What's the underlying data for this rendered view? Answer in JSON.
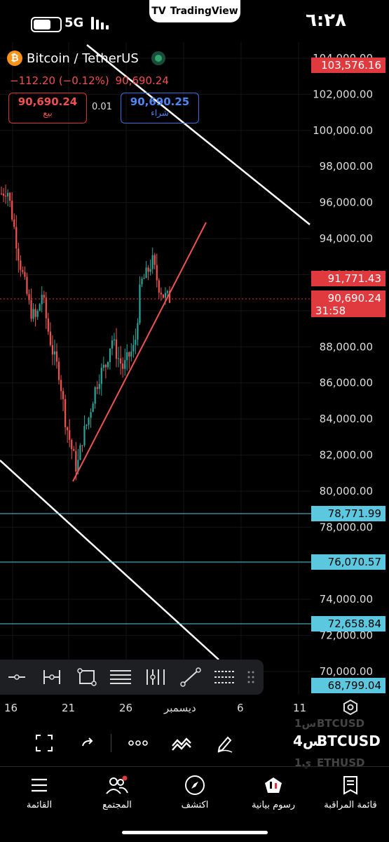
{
  "status_bar": {
    "time": "٦:٢٨",
    "network": "5G",
    "app_pill": "TradingView"
  },
  "symbol": {
    "name": "Bitcoin / TetherUS",
    "change": "−112.20 (−0.12%)",
    "last": "90,690.24",
    "sell": {
      "price": "90,690.24",
      "label": "بيع"
    },
    "buy": {
      "price": "90,690.25",
      "label": "شراء"
    },
    "spread": "0.01"
  },
  "price_axis": {
    "ticks": [
      "104,000.00",
      "102,000.00",
      "100,000.00",
      "98,000.00",
      "96,000.00",
      "94,000.00",
      "92,000.00",
      "90,000.00",
      "88,000.00",
      "86,000.00",
      "84,000.00",
      "82,000.00",
      "80,000.00",
      "78,000.00",
      "76,000.00",
      "74,000.00",
      "72,000.00",
      "70,000.00"
    ],
    "labels": {
      "top_level": "103,576.16",
      "upper_level": "91,771.43",
      "current_price": "90,690.24",
      "countdown": "31:58",
      "level_1": "78,771.99",
      "level_2": "76,070.57",
      "level_3": "72,658.84",
      "level_4": "68,799.04"
    }
  },
  "colors": {
    "up": "#26a69a",
    "down": "#ef5350",
    "trendline": "#ef5350",
    "channel": "#ffffff",
    "support": "#5bc8e0",
    "price_red": "#e0393e",
    "buy_blue": "#3b6fe0"
  },
  "date_axis": [
    "16",
    "21",
    "26",
    "ديسمبر",
    "6",
    "11"
  ],
  "drawing_toolbar": [
    "horizontal-line",
    "range",
    "rectangle",
    "parallel-channel",
    "fib-levels",
    "trend-line",
    "more-tools"
  ],
  "controls": {
    "symbol": "BTCUSD",
    "interval": "4س",
    "watchlist_above": [
      "BTCUSD",
      "1س"
    ],
    "watchlist_below": [
      "ETHUSD",
      "1ي"
    ]
  },
  "tabs": [
    {
      "label": "قائمة المراقبة",
      "icon": "watchlist-icon"
    },
    {
      "label": "رسوم بيانية",
      "icon": "chart-icon"
    },
    {
      "label": "اكتشف",
      "icon": "compass-icon"
    },
    {
      "label": "المجتمع",
      "icon": "community-icon"
    },
    {
      "label": "القائمة",
      "icon": "menu-icon"
    }
  ],
  "chart_data": {
    "type": "candlestick",
    "symbol": "BTCUSD",
    "interval": "4h",
    "ylim": [
      69500,
      104500
    ],
    "approx_path": [
      96500,
      96800,
      95000,
      93000,
      91500,
      90000,
      89500,
      91000,
      89000,
      87500,
      86500,
      84000,
      82500,
      81200,
      83000,
      84000,
      85500,
      86500,
      87000,
      88500,
      87500,
      86800,
      87500,
      88000,
      91500,
      92000,
      92800,
      91500,
      90800,
      90690
    ],
    "horizontal_levels": [
      78771.99,
      76070.57,
      72658.84,
      68799.04
    ]
  }
}
